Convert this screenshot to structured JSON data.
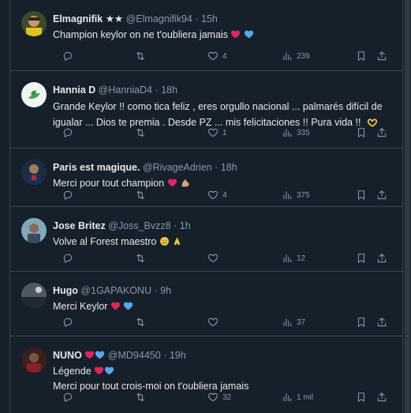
{
  "colors": {
    "background": "#15202b",
    "text": "#e7e9ea",
    "muted": "#8b98a5",
    "divider": "#38444d",
    "heart_red": "#e0245e",
    "heart_blue": "#5aa9e6"
  },
  "replies": [
    {
      "display_name": "Elmagnifik",
      "badge": "★★",
      "handle": "@Elmagnifik94",
      "separator": "·",
      "time": "15h",
      "lines": [
        "Champion keylor on ne t'oubliera jamais"
      ],
      "emoji": [
        "red-heart",
        "blue-heart"
      ],
      "reply_count": "",
      "retweet_count": "",
      "like_count": "4",
      "view_count": "239"
    },
    {
      "display_name": "Hannia D",
      "handle": "@HanniaD4",
      "separator": "·",
      "time": "18h",
      "lines": [
        "Grande Keylor !!  como tica feliz , eres orgullo nacional ... palmarés  difícil de",
        "igualar ... Dios te premia . Desde PZ ... mis felicitaciones !! Pura vida !!"
      ],
      "emoji": [
        "heart-hands"
      ],
      "reply_count": "",
      "retweet_count": "",
      "like_count": "1",
      "view_count": "335"
    },
    {
      "display_name": "Paris est magique.",
      "handle": "@RivageAdrien",
      "separator": "·",
      "time": "18h",
      "lines": [
        "Merci pour tout champion"
      ],
      "emoji": [
        "red-heart",
        "flexed-biceps"
      ],
      "reply_count": "",
      "retweet_count": "",
      "like_count": "4",
      "view_count": "375"
    },
    {
      "display_name": "Jose Britez",
      "handle": "@Joss_Bvzz8",
      "separator": "·",
      "time": "1h",
      "lines": [
        "Volve al Forest maestro"
      ],
      "emoji": [
        "smiling-face",
        "folded-hands"
      ],
      "reply_count": "",
      "retweet_count": "",
      "like_count": "",
      "view_count": "12"
    },
    {
      "display_name": "Hugo",
      "handle": "@1GAPAKONU",
      "separator": "·",
      "time": "9h",
      "lines": [
        "Merci Keylor"
      ],
      "emoji": [
        "red-heart",
        "blue-heart"
      ],
      "reply_count": "",
      "retweet_count": "",
      "like_count": "",
      "view_count": "37"
    },
    {
      "display_name": "NUNO",
      "handle": "@MD94450",
      "separator": "·",
      "time": "19h",
      "lines": [
        "Légende",
        "Merci pour tout crois-moi on t'oubliera jamais"
      ],
      "emoji": [
        "red-heart",
        "blue-heart"
      ],
      "reply_count": "",
      "retweet_count": "",
      "like_count": "32",
      "view_count": "1 mil"
    }
  ]
}
